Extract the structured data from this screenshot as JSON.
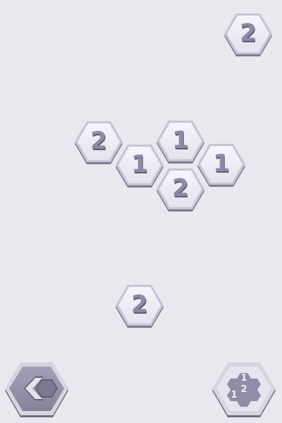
{
  "tiles": [
    {
      "value": "2"
    },
    {
      "value": "2"
    },
    {
      "value": "1"
    },
    {
      "value": "1"
    },
    {
      "value": "1"
    },
    {
      "value": "2"
    },
    {
      "value": "2"
    }
  ],
  "controls": {
    "back_icon": "back-hexagon-icon",
    "hint_icon": "hex-cluster-icon",
    "hint_numbers": [
      "1",
      "2",
      "1"
    ]
  },
  "colors": {
    "background": "#e9e8ee",
    "tile_face": "#eeeef6",
    "tile_side": "#8f8da7",
    "number": "#8c8aa4",
    "button_face": "#8f8da7"
  }
}
